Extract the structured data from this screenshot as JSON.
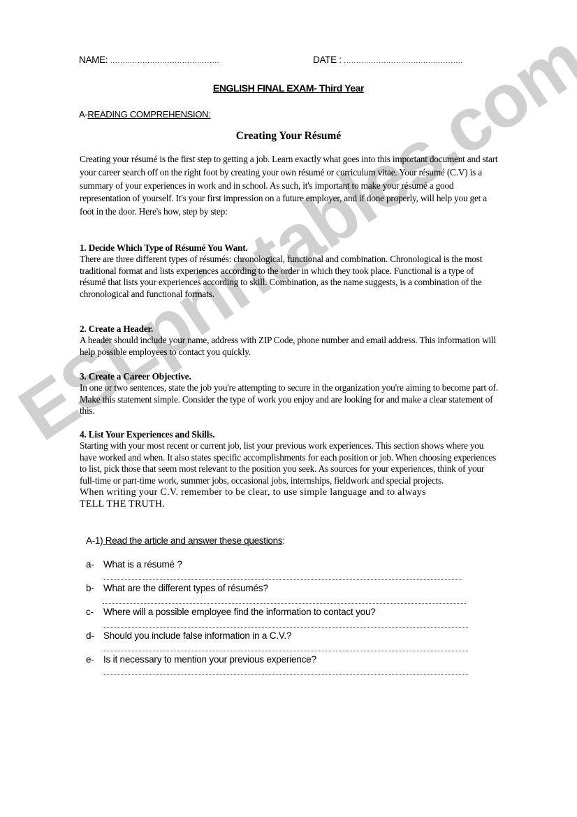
{
  "watermark": "ESLprintables.com",
  "header": {
    "name_label": "NAME:",
    "name_dots": "............................................",
    "date_label": "DATE :",
    "date_dots": "................................................"
  },
  "exam_title": "ENGLISH FINAL EXAM- Third Year",
  "section_a": {
    "prefix": "A-",
    "label": "READING COMPREHENSION:"
  },
  "article": {
    "title": "Creating Your Résumé",
    "intro": " Creating your résumé is the first step to getting a job. Learn exactly what goes into this important document and start your career search off on the right foot by creating your own résumé or curriculum vitae. Your résumé (C.V) is a summary of your experiences in work and in school. As such, it's important to make your résumé a good representation of yourself. It's your first impression on a future employer, and if done properly, will help you get a foot in the door. Here's how, step by step:",
    "sections": [
      {
        "heading": "1. Decide Which Type of Résumé You Want.",
        "text": "There are three different types of résumés: chronological, functional and combination. Chronological is the most traditional format and lists experiences according to the order in which they took place. Functional is a type of résumé that lists your experiences according to skill. Combination, as the name suggests, is a combination of the chronological and functional formats."
      },
      {
        "heading": "2. Create a Header.",
        "text": "A header should include your name, address with ZIP Code, phone number and email address. This information will help possible employees to contact you quickly."
      },
      {
        "heading": "3. Create a Career Objective.",
        "text": "In one or two sentences, state the job you're attempting to secure in the organization you're aiming to become part of. Make this statement simple. Consider the type of work you enjoy and are looking for and make a clear statement of this."
      },
      {
        "heading": "4. List Your Experiences and Skills.",
        "text": "Starting with your most recent or current job, list your previous work experiences. This section shows where you have worked and when. It also states specific accomplishments for each position or job. When choosing experiences to list, pick those that seem most relevant to the position you seek. As sources for your experiences, think of your full-time or part-time work, summer jobs, occasional jobs, internships, fieldwork and special projects."
      }
    ],
    "closing_1": "When writing your C.V. remember to be clear, to use simple language and to always",
    "closing_2": "TELL THE TRUTH."
  },
  "questions": {
    "prefix": "A-1)",
    "instruction": " Read the article and answer these questions",
    "suffix": ":",
    "items": [
      {
        "label": "a-",
        "text": "What is a résumé ?"
      },
      {
        "label": "b-",
        "text": "What are the different types of résumés?"
      },
      {
        "label": "c-",
        "text": "Where will a possible employee find the information to contact you?"
      },
      {
        "label": "d-",
        "text": "Should you include false information in a C.V.?"
      },
      {
        "label": "e-",
        "text": "Is it necessary to mention your previous experience?"
      }
    ]
  }
}
